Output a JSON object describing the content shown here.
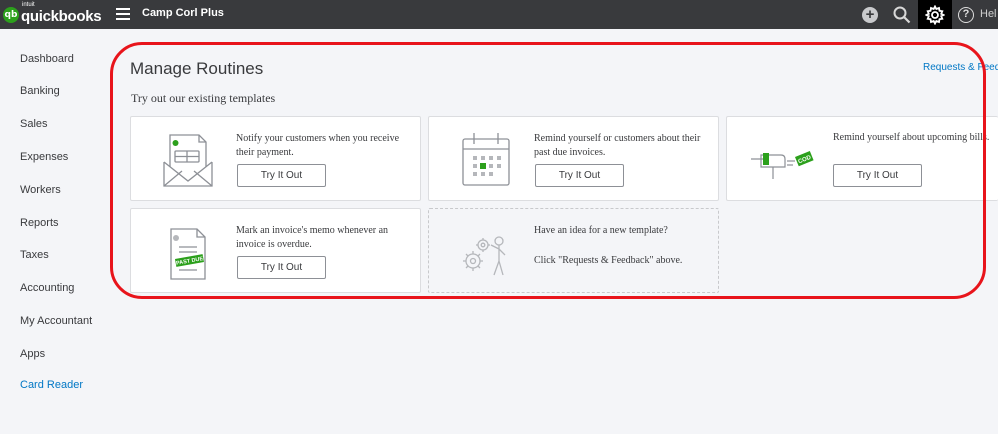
{
  "header": {
    "logo_badge": "qb",
    "logo_intuit": "intuit",
    "logo_text": "quickbooks",
    "company": "Camp Corl Plus",
    "help_label": "Hel"
  },
  "sidebar": {
    "items": [
      {
        "label": "Dashboard"
      },
      {
        "label": "Banking"
      },
      {
        "label": "Sales"
      },
      {
        "label": "Expenses"
      },
      {
        "label": "Workers"
      },
      {
        "label": "Reports"
      },
      {
        "label": "Taxes"
      },
      {
        "label": "Accounting"
      },
      {
        "label": "My Accountant"
      },
      {
        "label": "Apps"
      },
      {
        "label": "Card Reader"
      }
    ]
  },
  "main": {
    "title": "Manage Routines",
    "feedback_link": "Requests & Feed",
    "subtitle": "Try out our existing templates",
    "cards": [
      {
        "text": "Notify your customers when you receive their payment.",
        "button": "Try It Out"
      },
      {
        "text": "Remind yourself or customers about their past due invoices.",
        "button": "Try It Out"
      },
      {
        "text": "Remind yourself about upcoming bills.",
        "button": "Try It Out"
      },
      {
        "text": "Mark an invoice's memo whenever an invoice is overdue.",
        "button": "Try It Out"
      }
    ],
    "idea_card": {
      "line1": "Have an idea for a new template?",
      "line2": "Click \"Requests & Feedback\" above."
    },
    "past_due_stamp": "PAST DUE",
    "cod_tag": "COD"
  },
  "colors": {
    "topbar": "#393a3d",
    "brand_green": "#2ca01c",
    "link_blue": "#0077c5",
    "highlight_red": "#e8141b"
  }
}
